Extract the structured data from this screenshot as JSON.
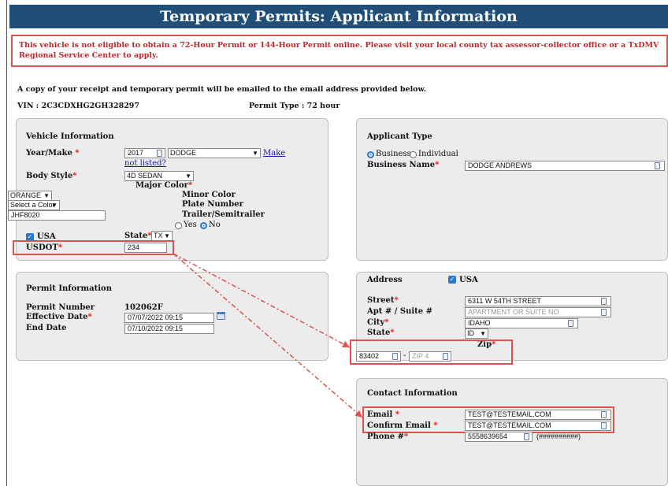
{
  "page": {
    "title": "Temporary Permits: Applicant Information",
    "banner": "This vehicle is not eligible to obtain a 72-Hour Permit or 144-Hour Permit online. Please visit your local county tax assessor-collector office or a TxDMV Regional Service Center to apply.",
    "receipt_note": "A copy of your receipt and temporary permit will be emailed to the email address provided below.",
    "vin_label": "VIN : 2C3CDXHG2GH328297",
    "permit_type_label": "Permit Type : 72 hour"
  },
  "vehicle": {
    "section_title": "Vehicle Information",
    "year_make_label": "Year/Make",
    "year_value": "2017",
    "make_value": "DODGE",
    "make_link": "Make",
    "make_link2": "not listed?",
    "body_style_label": "Body Style",
    "body_style_value": "4D SEDAN",
    "major_color_label": "Major Color",
    "major_color_value": "ORANGE",
    "minor_color_label": "Minor Color",
    "minor_color_value": "Select a Color",
    "plate_label": "Plate Number",
    "plate_value": "JHF8020",
    "trailer_label": "Trailer/Semitrailer",
    "yes_label": "Yes",
    "no_label": "No",
    "usa_label": "USA",
    "state_label": "State",
    "state_value": "TX",
    "usdot_label": "USDOT",
    "usdot_value": "234"
  },
  "permit": {
    "section_title": "Permit Information",
    "number_label": "Permit Number",
    "number_value": "102062F",
    "effective_label": "Effective Date",
    "effective_value": "07/07/2022 09:15",
    "end_label": "End Date",
    "end_value": "07/10/2022 09:15"
  },
  "applicant": {
    "section_title": "Applicant Type",
    "business_label": "Business",
    "individual_label": "Individual",
    "business_name_label": "Business Name",
    "business_name_value": "DODGE ANDREWS"
  },
  "address": {
    "section_title": "Address",
    "usa_label": "USA",
    "street_label": "Street",
    "street_value": "6311 W 54TH STREET",
    "apt_label": "Apt # / Suite #",
    "apt_placeholder": "APARTMENT OR SUITE NO",
    "city_label": "City",
    "city_value": "IDAHO",
    "state_label": "State",
    "state_value": "ID",
    "zip_label": "Zip",
    "zip_value": "83402",
    "zip4_placeholder": "ZIP 4",
    "dash": "-"
  },
  "contact": {
    "section_title": "Contact Information",
    "email_label": "Email",
    "email_value": "TEST@TESTEMAIL.COM",
    "confirm_label": "Confirm Email",
    "confirm_value": "TEST@TESTEMAIL.COM",
    "phone_label": "Phone #",
    "phone_value": "5558639654",
    "phone_format": "(##########)"
  },
  "required_mark": "*",
  "colors": {
    "header_bg": "#1f4e79",
    "highlight": "#d9534f",
    "required": "#d11111",
    "link": "#1a1aa6"
  }
}
